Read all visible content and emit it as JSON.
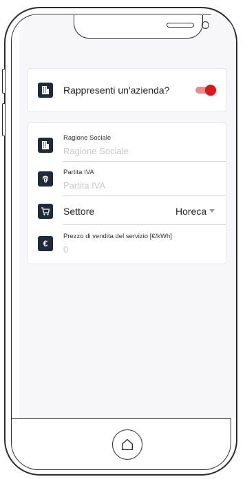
{
  "company_card": {
    "question_label": "Rappresenti un'azienda?",
    "toggle_on": true,
    "accent_color": "#d71a1a"
  },
  "form": {
    "ragione_sociale": {
      "label": "Ragione Sociale",
      "placeholder": "Ragione Sociale"
    },
    "partita_iva": {
      "label": "Partita IVA",
      "placeholder": "Partita IVA"
    },
    "settore": {
      "label": "Settore",
      "value": "Horeca"
    },
    "prezzo": {
      "label": "Prezzo di vendita del servizio [€/kWh]",
      "placeholder": "0",
      "icon_glyph": "€"
    }
  },
  "icons": [
    "building-icon",
    "fingerprint-icon",
    "cart-icon",
    "euro-icon",
    "home-icon",
    "chevron-down-icon"
  ]
}
